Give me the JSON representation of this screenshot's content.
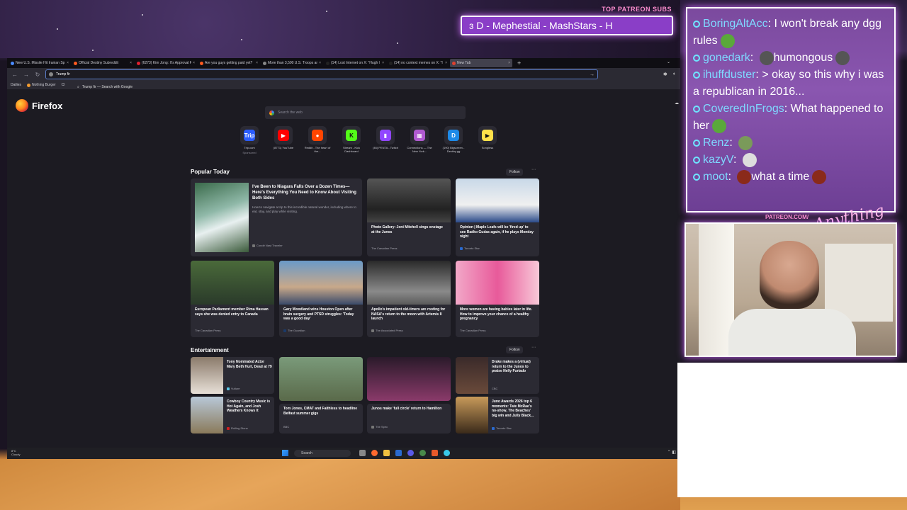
{
  "overlay": {
    "patreon_subs_label": "TOP PATREON SUBS",
    "ticker_text": "ɜ D - Mephestial - MashStars - H",
    "patreon_url": "PATREON.COM/",
    "signature": "Anything Goes"
  },
  "browser": {
    "tabs": [
      {
        "title": "New U.S. Missile Hit Iranian Sp",
        "color": "#4a8bff"
      },
      {
        "title": "Official Destiny Subreddit",
        "color": "#ff5a1f"
      },
      {
        "title": "(6273) Kim Jong: It's Approval R",
        "color": "#e0202f"
      },
      {
        "title": "Are you guys getting paid yet?",
        "color": "#ff5a1f"
      },
      {
        "title": "More than 3,500 U.S. Troops ar",
        "color": "#888888"
      },
      {
        "title": "(14) Lost Internet on X: \"Hugh l",
        "color": "#222222"
      },
      {
        "title": "(14) no context memes on X: \"I",
        "color": "#222222"
      },
      {
        "title": "New Tab",
        "color": "#e0402f"
      }
    ],
    "new_tab_symbol": "+",
    "url_value": "Trump fir",
    "suggestion": "Trump fir — Search with Google",
    "bookmarks": [
      "Dailies",
      "Nothing Burger",
      "Cl"
    ]
  },
  "newtab": {
    "brand": "Firefox",
    "search_placeholder": "Search the web",
    "shortcuts": [
      {
        "label": "Trip.com",
        "sub": "Sponsored",
        "glyph": "Trip",
        "color": "#2a5cff"
      },
      {
        "label": "(8771) YouTube",
        "sub": "",
        "glyph": "▶",
        "color": "#ff0000"
      },
      {
        "label": "Reddit - The heart of the...",
        "sub": "",
        "glyph": "●",
        "color": "#ff4500"
      },
      {
        "label": "Stream - Kick Dashboard",
        "sub": "",
        "glyph": "K",
        "color": "#53fc18"
      },
      {
        "label": "(46) PENTA - Twitch",
        "sub": "",
        "glyph": "▮",
        "color": "#9146ff"
      },
      {
        "label": "Connections — The New York...",
        "sub": "",
        "glyph": "▦",
        "color": "#b05ad0"
      },
      {
        "label": "(190) Bigscreen - Destiny.gg",
        "sub": "",
        "glyph": "D",
        "color": "#1d8ae8"
      },
      {
        "label": "Songless",
        "sub": "",
        "glyph": "▶",
        "color": "#ffe14a"
      }
    ],
    "popular": {
      "title": "Popular Today",
      "follow": "Follow",
      "more": "⋯",
      "featured": {
        "title": "I've Been to Niagara Falls Over a Dozen Times—Here's Everything You Need to Know About Visiting Both Sides",
        "desc": "How to navigate a trip to this incredible natural wonder, including where to eat, stay, and play while visiting.",
        "source": "Condé Nast Traveler"
      },
      "cards": [
        {
          "title": "Photo Gallery: Joni Mitchell sings onstage at the Junos",
          "source": "The Canadian Press"
        },
        {
          "title": "Opinion | Maple Leafs will be 'fired up' to see Radko Gudas again, if he plays Monday night",
          "source": "Toronto Star"
        },
        {
          "title": "European Parliament member Rima Hassan says she was denied entry to Canada",
          "source": "The Canadian Press"
        },
        {
          "title": "Gary Woodland wins Houston Open after brain surgery and PTSD struggles: 'Today was a good day'",
          "source": "The Guardian"
        },
        {
          "title": "Apollo's impatient old-timers are rooting for NASA's return to the moon with Artemis II launch",
          "source": "The Associated Press"
        },
        {
          "title": "More women are having babies later in life. How to improve your chance of a healthy pregnancy",
          "source": "The Canadian Press"
        }
      ]
    },
    "entertainment": {
      "title": "Entertainment",
      "follow": "Follow",
      "more": "⋯",
      "cards": [
        {
          "title": "Tony Nominated Actor Mary Beth Hurt, Dead at 79",
          "source": "Vulture"
        },
        {
          "title": "",
          "source": ""
        },
        {
          "title": "",
          "source": ""
        },
        {
          "title": "Drake makes a (virtual) return to the Junos to praise Nelly Furtado",
          "source": "CBC"
        },
        {
          "title": "Cowboy Country Music is Hot Again, and Josh Weathers Knows It",
          "source": "Rolling Stone"
        },
        {
          "title": "Tom Jones, CMAT and Faithless to headline Belfast summer gigs",
          "source": "BBC"
        },
        {
          "title": "Junos make 'full circle' return to Hamilton",
          "source": "The Spec"
        },
        {
          "title": "Juno Awards 2026 top 6 moments: Tate McRae's no-show, The Beaches' big win and Jully Black...",
          "source": "Toronto Star"
        }
      ]
    }
  },
  "taskbar": {
    "weather_temp": "8°C",
    "weather_desc": "Cloudy",
    "search": "Search"
  },
  "chat": [
    {
      "user": "BoringAltAcc",
      "msg": "I won't break any dgg rules",
      "emote": "#5aa83a"
    },
    {
      "user": "gonedark",
      "msg": "humongous",
      "emote": "#555555",
      "emote_first": true
    },
    {
      "user": "ihuffduster",
      "msg": "> okay so this why i was a republican in 2016...",
      "emote": ""
    },
    {
      "user": "CoveredInFrogs",
      "msg": "What happened to her",
      "emote": "#5aa83a"
    },
    {
      "user": "Renz",
      "msg": "",
      "emote": "#7a9a5a"
    },
    {
      "user": "kazyV",
      "msg": "",
      "emote": "#dddddd"
    },
    {
      "user": "moot",
      "msg": "what a time",
      "emote": "#8a2a1a",
      "emote_first": true
    }
  ]
}
